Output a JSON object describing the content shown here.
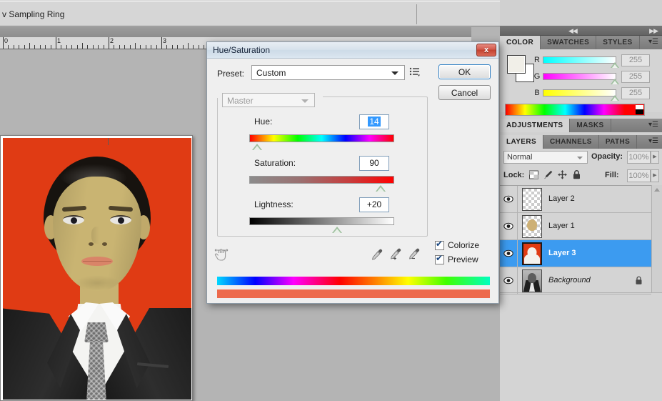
{
  "options_bar": {
    "sampling_ring_label": "v Sampling Ring"
  },
  "ruler": {
    "unit_marks": [
      "0",
      "1",
      "2",
      "3"
    ]
  },
  "dialog": {
    "title": "Hue/Saturation",
    "close_label": "x",
    "preset_label": "Preset:",
    "preset_value": "Custom",
    "preset_menu_icon": "preset-list-icon",
    "ok_label": "OK",
    "cancel_label": "Cancel",
    "channel_value": "Master",
    "sliders": [
      {
        "label": "Hue:",
        "value": "14",
        "selected": true,
        "thumb_pct": 5
      },
      {
        "label": "Saturation:",
        "value": "90",
        "selected": false,
        "thumb_pct": 90
      },
      {
        "label": "Lightness:",
        "value": "+20",
        "selected": false,
        "thumb_pct": 60
      }
    ],
    "targeted_adjust_icon": "targeted-adjustment-hand-icon",
    "eyedroppers": [
      {
        "icon": "eyedropper-icon"
      },
      {
        "icon": "eyedropper-plus-icon"
      },
      {
        "icon": "eyedropper-minus-icon"
      }
    ],
    "checkboxes": [
      {
        "label": "Colorize",
        "checked": true
      },
      {
        "label": "Preview",
        "checked": true
      }
    ],
    "result_color": "#ed6a4c"
  },
  "color_panel": {
    "tabs": [
      {
        "label": "COLOR",
        "active": true
      },
      {
        "label": "SWATCHES",
        "active": false
      },
      {
        "label": "STYLES",
        "active": false
      }
    ],
    "channels": [
      {
        "letter": "R",
        "value": "255",
        "thumb_pct": 100
      },
      {
        "letter": "G",
        "value": "255",
        "thumb_pct": 100
      },
      {
        "letter": "B",
        "value": "255",
        "thumb_pct": 100
      }
    ],
    "foreground": "#f1efe8",
    "background": "#ffffff"
  },
  "adjustments_panel": {
    "tabs": [
      {
        "label": "ADJUSTMENTS",
        "active": true
      },
      {
        "label": "MASKS",
        "active": false
      }
    ]
  },
  "layers_panel": {
    "tabs": [
      {
        "label": "LAYERS",
        "active": true
      },
      {
        "label": "CHANNELS",
        "active": false
      },
      {
        "label": "PATHS",
        "active": false
      }
    ],
    "blend_mode": "Normal",
    "opacity_label": "Opacity:",
    "opacity_value": "100%",
    "lock_label": "Lock:",
    "fill_label": "Fill:",
    "fill_value": "100%",
    "lock_icons": [
      "lock-transparency-icon",
      "lock-image-icon",
      "lock-position-icon",
      "lock-all-icon"
    ],
    "layers": [
      {
        "name": "Layer 2",
        "selected": false,
        "locked": false,
        "italic": false,
        "thumb": "empty"
      },
      {
        "name": "Layer 1",
        "selected": false,
        "locked": false,
        "italic": false,
        "thumb": "skin"
      },
      {
        "name": "Layer 3",
        "selected": true,
        "locked": false,
        "italic": false,
        "thumb": "red-portrait"
      },
      {
        "name": "Background",
        "selected": false,
        "locked": true,
        "italic": true,
        "thumb": "gray-portrait"
      }
    ]
  }
}
